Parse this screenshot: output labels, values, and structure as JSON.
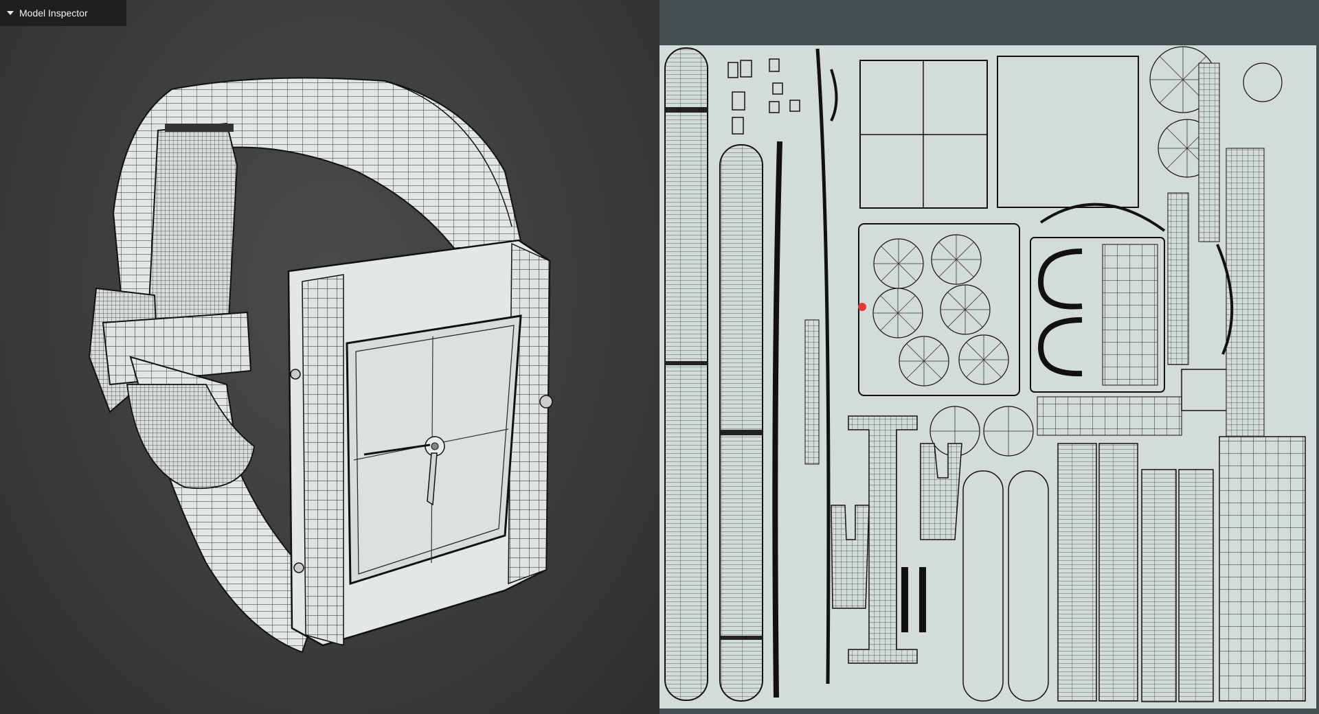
{
  "inspector": {
    "label": "Model Inspector",
    "icon": "caret-down-icon"
  },
  "colors": {
    "viewport_bg": "#3c3c3c",
    "mesh_fill": "#dfe3e3",
    "wire": "#1a1a1a",
    "uv_bg": "#d3dbdb",
    "uv_panel_bg": "#434e4f",
    "cursor": "#e23a3a"
  }
}
